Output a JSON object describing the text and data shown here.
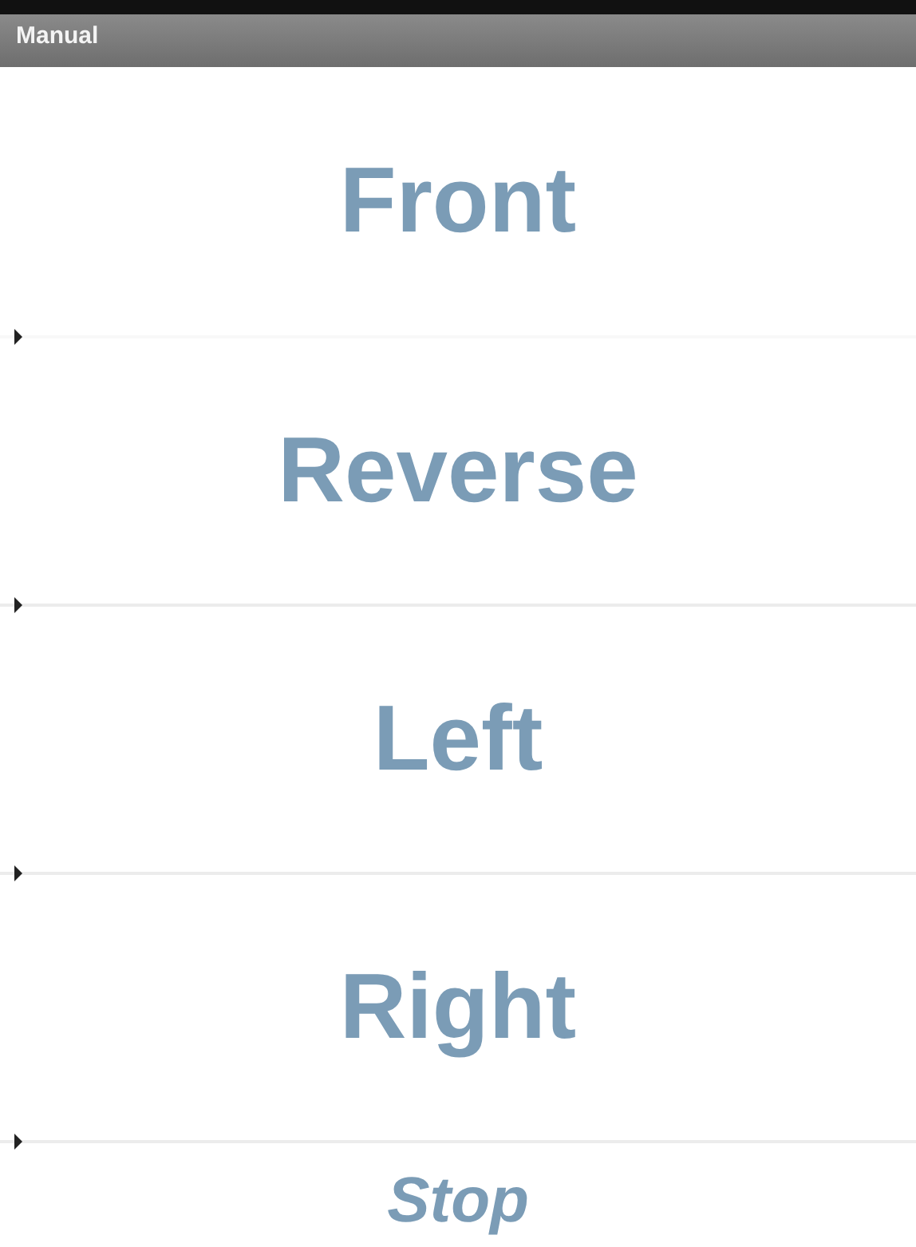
{
  "window": {
    "title": "Manual"
  },
  "buttons": [
    {
      "label": "Front",
      "kind": "move"
    },
    {
      "label": "Reverse",
      "kind": "move"
    },
    {
      "label": "Left",
      "kind": "move"
    },
    {
      "label": "Right",
      "kind": "move"
    },
    {
      "label": "Stop",
      "kind": "stop"
    }
  ]
}
